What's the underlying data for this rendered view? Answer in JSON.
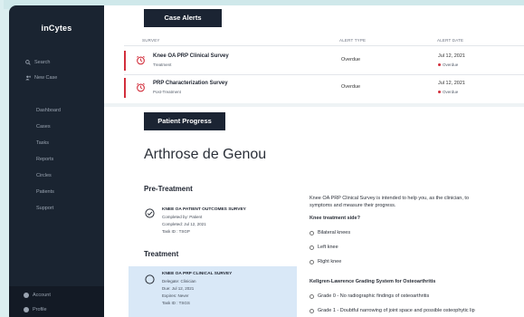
{
  "app": {
    "logo": "inCytes"
  },
  "sidebar": {
    "search": "Search",
    "new_case": "New Case",
    "items": [
      "Dashboard",
      "Cases",
      "Tasks",
      "Reports",
      "Circles",
      "Patients",
      "Support"
    ],
    "bottom": {
      "account": "Account",
      "profile": "Profile"
    }
  },
  "alerts": {
    "title": "Case Alerts",
    "columns": {
      "survey": "SURVEY",
      "alert_type": "ALERT TYPE",
      "alert_date": "ALERT DATE"
    },
    "rows": [
      {
        "title": "Knee OA PRP Clinical Survey",
        "sub": "Treatment",
        "type": "Overdue",
        "date": "Jul 12, 2021",
        "status": "Overdue"
      },
      {
        "title": "PRP Characterization Survey",
        "sub": "Post-Treatment",
        "type": "Overdue",
        "date": "Jul 12, 2021",
        "status": "Overdue"
      }
    ],
    "accent_color": "#d22f3c"
  },
  "progress": {
    "title": "Patient Progress",
    "patient": "Arthrose de Genou",
    "pre_treatment": {
      "label": "Pre-Treatment",
      "task": {
        "title": "KNEE OA PATIENT OUTCOMES SURVEY",
        "line1": "Completed by: Patient",
        "line2": "Completed: Jul 12, 2021",
        "line3": "Task ID : TSGP"
      }
    },
    "treatment": {
      "label": "Treatment",
      "task": {
        "title": "KNEE OA PRP CLINICAL SURVEY",
        "line1": "Delegate: Clinician",
        "line2": "Due: Jul 12, 2021",
        "line3": "Expires: Never",
        "line4": "Task ID : TSGS"
      }
    },
    "detail": {
      "intro_1": "Knee OA PRP Clinical Survey is intended to help you, as the clinician, to",
      "intro_2": "symptoms and measure their progress.",
      "q1": "Knee treatment side?",
      "q1_options": [
        "Bilateral knees",
        "Left knee",
        "Right knee"
      ],
      "q2": "Kellgren-Lawrence Grading System for Osteoarthritis",
      "q2_options": [
        "Grade 0 - No radiographic findings of osteoarthritis",
        "Grade 1 - Doubtful narrowing of joint space and possible osteophytic lip"
      ]
    }
  }
}
